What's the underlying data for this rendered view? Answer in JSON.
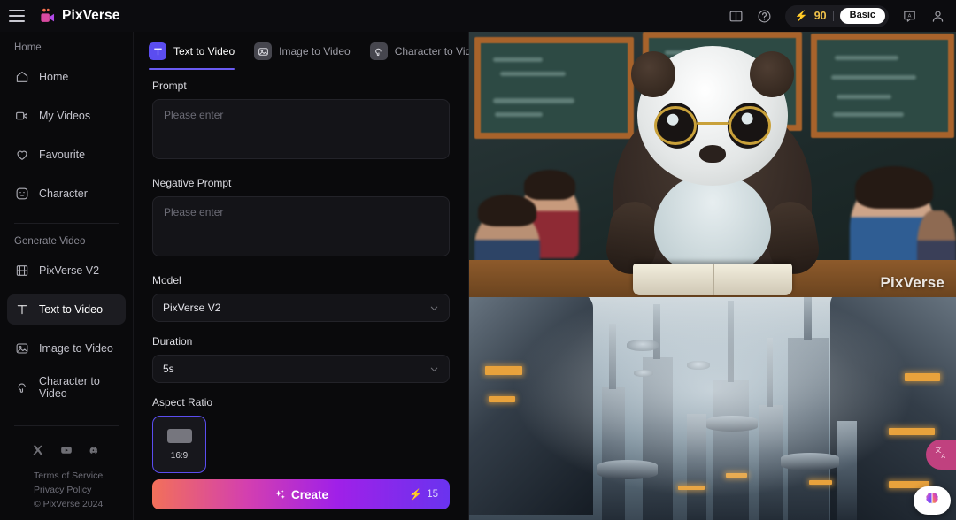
{
  "app": {
    "brand": "PixVerse",
    "menu_icon": "hamburger-icon",
    "logo_icon": "video-camera-logo-icon"
  },
  "header": {
    "book_icon": "book-icon",
    "help_icon": "help-circle-icon",
    "credits": "90",
    "credits_icon": "lightning-bolt-icon",
    "plan": "Basic",
    "language_icon": "language-icon",
    "account_icon": "user-avatar-icon"
  },
  "sidebar": {
    "section_home": "Home",
    "home_items": [
      {
        "label": "Home",
        "icon": "home-icon"
      },
      {
        "label": "My Videos",
        "icon": "video-camera-icon"
      },
      {
        "label": "Favourite",
        "icon": "heart-icon"
      },
      {
        "label": "Character",
        "icon": "smiley-face-icon"
      }
    ],
    "section_generate": "Generate Video",
    "generate_items": [
      {
        "label": "PixVerse V2",
        "icon": "film-strip-icon",
        "active": false
      },
      {
        "label": "Text to Video",
        "icon": "text-t-icon",
        "active": true
      },
      {
        "label": "Image to Video",
        "icon": "image-icon",
        "active": false
      },
      {
        "label": "Character to Video",
        "icon": "character-head-icon",
        "active": false
      }
    ],
    "socials": [
      {
        "name": "x-twitter-icon"
      },
      {
        "name": "youtube-icon"
      },
      {
        "name": "discord-icon"
      }
    ],
    "legal": {
      "terms": "Terms of Service",
      "privacy": "Privacy Policy",
      "copyright": "© PixVerse 2024"
    }
  },
  "panel": {
    "tabs": [
      {
        "label": "Text to Video",
        "icon": "text-t-icon",
        "active": true
      },
      {
        "label": "Image to Video",
        "icon": "image-icon",
        "active": false
      },
      {
        "label": "Character to Video",
        "icon": "character-head-icon",
        "active": false
      }
    ],
    "prompt": {
      "label": "Prompt",
      "placeholder": "Please enter",
      "value": ""
    },
    "negative_prompt": {
      "label": "Negative Prompt",
      "placeholder": "Please enter",
      "value": ""
    },
    "model": {
      "label": "Model",
      "value": "PixVerse V2",
      "chevron_icon": "chevron-down-icon"
    },
    "duration": {
      "label": "Duration",
      "value": "5s",
      "chevron_icon": "chevron-down-icon"
    },
    "aspect_ratio": {
      "label": "Aspect Ratio",
      "options": [
        {
          "label": "16:9",
          "selected": true
        }
      ]
    },
    "create": {
      "label": "Create",
      "sparkle_icon": "sparkle-icon",
      "cost": "15",
      "cost_icon": "lightning-bolt-icon"
    }
  },
  "gallery": {
    "items": [
      {
        "name": "panda-classroom-video",
        "description": "Cartoon panda wearing round gold glasses sitting at a school desk with an open book, surrounded by children in a classroom with green chalkboards",
        "watermark": "PixVerse"
      },
      {
        "name": "futuristic-city-video",
        "description": "Sci-fi megacity with towering spires, layered platforms and flying ships in a hazy blue sky",
        "watermark": ""
      }
    ]
  },
  "floating": {
    "translate_icon": "translate-icon",
    "ai-assistant_icon": "brain-icon"
  },
  "colors": {
    "accent": "#5b4df0",
    "brand_pink": "#d9488f",
    "credit_gold": "#f0c24a",
    "panel_bg": "#0a0a0c",
    "field_bg": "#141418"
  }
}
